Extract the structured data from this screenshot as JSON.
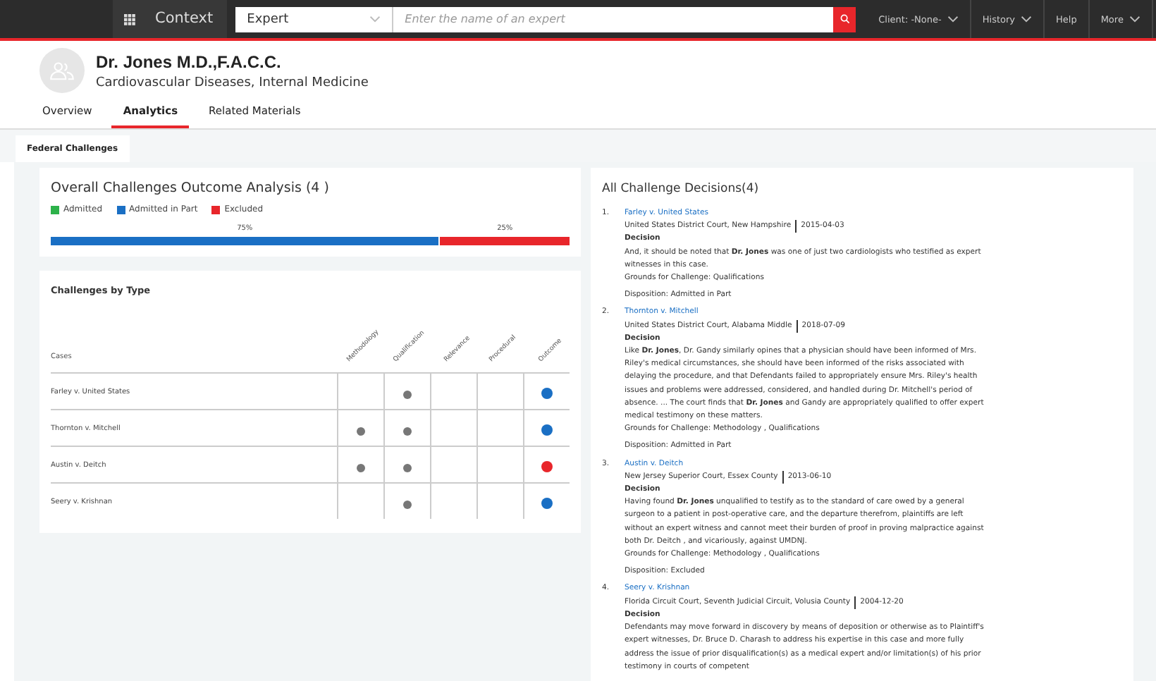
{
  "topbar": {
    "brand": "Context",
    "search_type": "Expert",
    "search": {
      "placeholder": "Enter the name of an expert"
    },
    "menus": [
      {
        "label": "Client: -None-",
        "dropdown": true
      },
      {
        "label": "History",
        "dropdown": true
      },
      {
        "label": "Help",
        "dropdown": false
      },
      {
        "label": "More",
        "dropdown": true
      }
    ]
  },
  "profile": {
    "name": "Dr. Jones M.D.,F.A.C.C.",
    "specialty": "Cardiovascular Diseases, Internal Medicine"
  },
  "tabs": [
    {
      "label": "Overview",
      "selected": false
    },
    {
      "label": "Analytics",
      "selected": true
    },
    {
      "label": "Related Materials",
      "selected": false
    }
  ],
  "subtabs": [
    {
      "label": "Federal Challenges",
      "selected": true
    }
  ],
  "outcome_card": {
    "title": "Overall Challenges Outcome Analysis (4 )",
    "legend": [
      {
        "label": "Admitted",
        "color": "#2db24a"
      },
      {
        "label": "Admitted in Part",
        "color": "#1a6fc4"
      },
      {
        "label": "Excluded",
        "color": "#e8262b"
      }
    ],
    "segments": [
      {
        "label": "75%",
        "color": "#1a6fc4"
      },
      {
        "label": "25%",
        "color": "#e8262b"
      }
    ]
  },
  "type_card": {
    "title": "Challenges by Type",
    "columns": [
      "Cases",
      "Methodology",
      "Qualification",
      "Relevance",
      "Procedural",
      "Outcome"
    ],
    "rows": [
      {
        "case": "Farley v. United States",
        "marks": [
          false,
          true,
          false,
          false
        ],
        "color": "#1a6fc4"
      },
      {
        "case": "Thornton v. Mitchell",
        "marks": [
          true,
          true,
          false,
          false
        ],
        "color": "#1a6fc4"
      },
      {
        "case": "Austin v. Deitch",
        "marks": [
          true,
          true,
          false,
          false
        ],
        "color": "#e8262b"
      },
      {
        "case": "Seery v. Krishnan",
        "marks": [
          false,
          true,
          false,
          false
        ],
        "color": "#1a6fc4"
      }
    ]
  },
  "decisions": {
    "title": "All Challenge Decisions(4)",
    "items": [
      {
        "number": "1.",
        "case": "Farley v. United States",
        "court": "United States District Court, New Hampshire",
        "date": "2015-04-03",
        "decision_label": "Decision",
        "text": "And, it should be noted that **Dr. Jones** was one of just two cardiologists who testified as expert witnesses in this case.",
        "grounds": "Grounds for Challenge:  Qualifications",
        "disposition": "Disposition: Admitted in Part"
      },
      {
        "number": "2.",
        "case": "Thornton v. Mitchell",
        "court": "United States District Court, Alabama Middle",
        "date": "2018-07-09",
        "decision_label": "Decision",
        "text": "Like **Dr. Jones**, Dr. Gandy similarly opines that a physician should have been informed of Mrs. Riley's medical circumstances, she should have been informed of the risks associated with delaying the procedure, and that Defendants failed to appropriately ensure Mrs. Riley's health issues and problems were addressed, considered, and handled during Dr. Mitchell's period of absence. ... The court finds that **Dr. Jones** and Gandy are appropriately qualified to offer expert medical testimony on these matters.",
        "grounds": "Grounds for Challenge:  Methodology ,  Qualifications",
        "disposition": "Disposition: Admitted in Part"
      },
      {
        "number": "3.",
        "case": "Austin v. Deitch",
        "court": "New Jersey Superior Court, Essex County",
        "date": "2013-06-10",
        "decision_label": "Decision",
        "text": "Having found **Dr. Jones** unqualified to testify as to the standard of care owed by a general surgeon to a patient in post-operative care, and the departure therefrom, plaintiffs are left without an expert witness and cannot meet their burden of proof in proving malpractice against both Dr. Deitch , and vicariously, against UMDNJ.",
        "grounds": "Grounds for Challenge:  Methodology ,  Qualifications",
        "disposition": "Disposition: Excluded"
      },
      {
        "number": "4.",
        "case": "Seery v. Krishnan",
        "court": "Florida Circuit Court, Seventh Judicial Circuit, Volusia County",
        "date": "2004-12-20",
        "decision_label": "Decision",
        "text": "Defendants may move forward in discovery by means of deposition or otherwise as to Plaintiff's expert witnesses, Dr. Bruce D. Charash to address his expertise in this case and more fully address the issue of prior disqualification(s) as a medical expert and/or limitation(s) of his prior testimony in courts of competent"
      }
    ]
  }
}
